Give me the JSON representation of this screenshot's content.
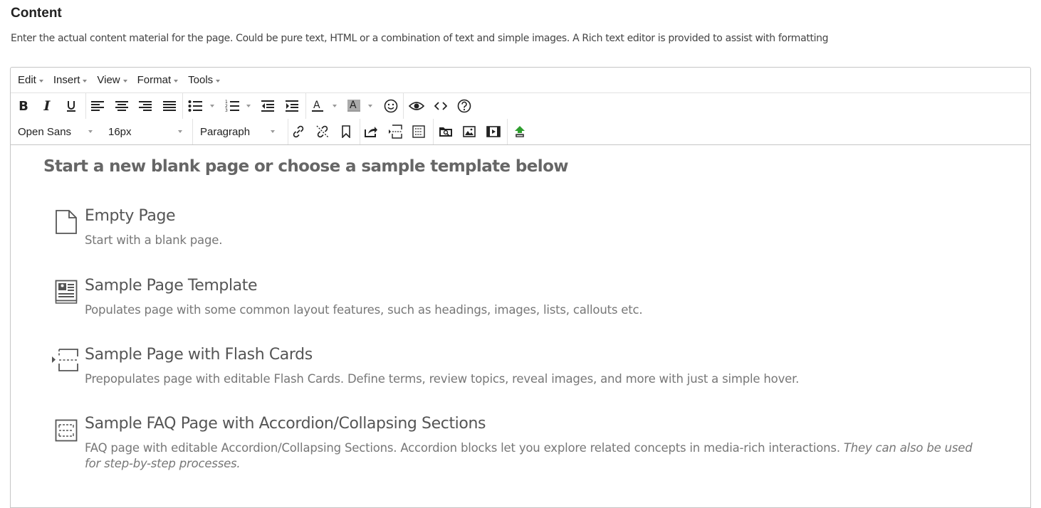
{
  "section": {
    "title": "Content",
    "description": "Enter the actual content material for the page. Could be pure text, HTML or a combination of text and simple images. A Rich text editor is provided to assist with formatting"
  },
  "editor": {
    "menubar": [
      "Edit",
      "Insert",
      "View",
      "Format",
      "Tools"
    ],
    "toolbar": {
      "font_family": "Open Sans",
      "font_size": "16px",
      "block_format": "Paragraph",
      "buttons": [
        "bold-icon",
        "italic-icon",
        "underline-icon",
        "align-left-icon",
        "align-center-icon",
        "align-right-icon",
        "align-justify-icon",
        "bullet-list-icon",
        "numbered-list-icon",
        "outdent-icon",
        "indent-icon",
        "text-color-icon",
        "background-color-icon",
        "emoticon-icon",
        "preview-icon",
        "source-code-icon",
        "help-icon",
        "link-icon",
        "unlink-icon",
        "bookmark-icon",
        "insert-template-icon",
        "flash-card-icon",
        "accordion-icon",
        "file-browser-icon",
        "image-icon",
        "media-icon",
        "upload-icon"
      ],
      "colors": {
        "text_color": "#222222",
        "background_color": "#999999",
        "upload_accent": "#2e9e2e"
      }
    },
    "content": {
      "heading": "Start a new blank page or choose a sample template below",
      "templates": [
        {
          "icon": "document-icon",
          "title": "Empty Page",
          "description": "Start with a blank page."
        },
        {
          "icon": "page-layout-icon",
          "title": "Sample Page Template",
          "description": "Populates page with some common layout features, such as headings, images, lists, callouts etc."
        },
        {
          "icon": "flash-card-icon",
          "title": "Sample Page with Flash Cards",
          "description": "Prepopulates page with editable Flash Cards. Define terms, review topics, reveal images, and more with just a simple hover."
        },
        {
          "icon": "accordion-icon",
          "title": "Sample FAQ Page with Accordion/Collapsing Sections",
          "description": "FAQ page with editable Accordion/Collapsing Sections. Accordion blocks let you explore related concepts in media-rich interactions. ",
          "description_emphasis": "They can also be used for step-by-step processes."
        }
      ]
    }
  }
}
